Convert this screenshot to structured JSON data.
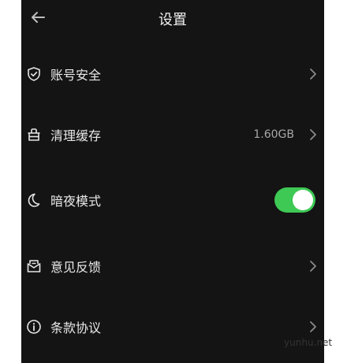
{
  "header": {
    "title": "设置",
    "back_icon": "arrow-left-icon"
  },
  "settings": {
    "account_security": {
      "label": "账号安全",
      "icon": "shield-icon"
    },
    "clear_cache": {
      "label": "清理缓存",
      "value": "1.60GB",
      "icon": "basket-icon"
    },
    "dark_mode": {
      "label": "暗夜模式",
      "icon": "moon-icon",
      "enabled": true
    },
    "feedback": {
      "label": "意见反馈",
      "icon": "envelope-icon"
    },
    "terms": {
      "label": "条款协议",
      "icon": "info-icon"
    }
  },
  "colors": {
    "background": "#141414",
    "toggle_on": "#3ec955",
    "text": "#e9e9e9",
    "value_text": "#a8a8a8"
  },
  "watermark": "yunhu.net"
}
